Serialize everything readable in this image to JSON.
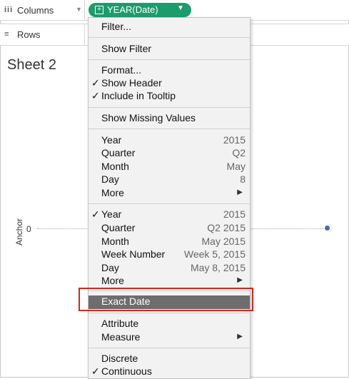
{
  "shelves": {
    "columns_label": "Columns",
    "columns_icon": "columns-shelf-icon",
    "rows_label": "Rows",
    "rows_icon": "rows-shelf-icon",
    "pill_label": "YEAR(Date)",
    "pill_color": "#1c9b6c"
  },
  "sheet": {
    "title": "Sheet 2",
    "axis_title": "Anchor",
    "axis_tick": "0",
    "point_color": "#3f6db0"
  },
  "menu": {
    "items": {
      "filter": "Filter...",
      "show_filter": "Show Filter",
      "format": "Format...",
      "show_header": "Show Header",
      "include_tooltip": "Include in Tooltip",
      "show_missing": "Show Missing Values",
      "d_year": "Year",
      "d_year_value": "2015",
      "d_quarter": "Quarter",
      "d_quarter_value": "Q2",
      "d_month": "Month",
      "d_month_value": "May",
      "d_day": "Day",
      "d_day_value": "8",
      "d_more": "More",
      "c_year": "Year",
      "c_year_value": "2015",
      "c_quarter": "Quarter",
      "c_quarter_value": "Q2 2015",
      "c_month": "Month",
      "c_month_value": "May 2015",
      "c_week": "Week Number",
      "c_week_value": "Week 5, 2015",
      "c_day": "Day",
      "c_day_value": "May 8, 2015",
      "c_more": "More",
      "exact_date": "Exact Date",
      "attribute": "Attribute",
      "measure": "Measure",
      "discrete": "Discrete",
      "continuous": "Continuous"
    },
    "checked": [
      "show_header",
      "include_tooltip",
      "c_year",
      "continuous"
    ],
    "highlighted": "exact_date",
    "highlight_color": "#6d6d6d",
    "callout_color": "#d7261c"
  }
}
